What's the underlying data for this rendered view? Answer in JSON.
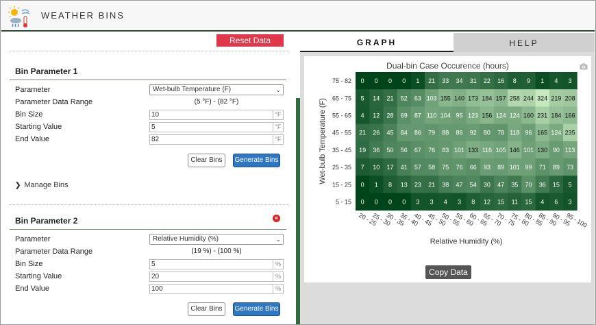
{
  "app": {
    "title": "WEATHER BINS",
    "logo_icon": "weather-logo-icon"
  },
  "left": {
    "reset_label": "Reset Data",
    "bin1": {
      "title": "Bin Parameter 1",
      "parameter_label": "Parameter",
      "parameter_value": "Wet-bulb Temperature (F)",
      "range_label": "Parameter Data Range",
      "range_value": "(5 °F) - (82 °F)",
      "size_label": "Bin Size",
      "size_value": "10",
      "start_label": "Starting Value",
      "start_value": "5",
      "end_label": "End Value",
      "end_value": "82",
      "unit": "°F",
      "clear_label": "Clear Bins",
      "generate_label": "Generate Bins"
    },
    "manage_label": "Manage Bins",
    "bin2": {
      "title": "Bin Parameter 2",
      "parameter_label": "Parameter",
      "parameter_value": "Relative Humidity (%)",
      "range_label": "Parameter Data Range",
      "range_value": "(19 %) - (100 %)",
      "size_label": "Bin Size",
      "size_value": "5",
      "start_label": "Starting Value",
      "start_value": "20",
      "end_label": "End Value",
      "end_value": "100",
      "unit": "%",
      "clear_label": "Clear Bins",
      "generate_label": "Generate Bins"
    }
  },
  "right": {
    "tab_graph": "GRAPH",
    "tab_help": "HELP",
    "copy_label": "Copy Data"
  },
  "chart_data": {
    "type": "heatmap",
    "title": "Dual-bin Case Occurence (hours)",
    "xlabel": "Relative Humidity (%)",
    "ylabel": "Wet-bulb Temperature (F)",
    "x": [
      "20 - 25",
      "25 - 30",
      "30 - 35",
      "35 - 40",
      "40 - 45",
      "45 - 50",
      "50 - 55",
      "55 - 60",
      "60 - 65",
      "65 - 70",
      "70 - 75",
      "75 - 80",
      "80 - 85",
      "85 - 90",
      "90 - 95",
      "95 - 100"
    ],
    "y": [
      "75 - 82",
      "65 - 75",
      "55 - 65",
      "45 - 55",
      "35 - 45",
      "25 - 35",
      "15 - 25",
      "5 - 15"
    ],
    "values": [
      [
        0,
        0,
        0,
        0,
        1,
        21,
        33,
        34,
        31,
        22,
        16,
        8,
        9,
        1,
        4,
        3
      ],
      [
        5,
        14,
        21,
        52,
        63,
        103,
        155,
        140,
        173,
        184,
        157,
        258,
        244,
        324,
        219,
        208
      ],
      [
        4,
        12,
        28,
        69,
        87,
        110,
        104,
        95,
        123,
        156,
        124,
        124,
        160,
        231,
        184,
        166
      ],
      [
        21,
        26,
        45,
        84,
        86,
        79,
        88,
        86,
        92,
        80,
        78,
        118,
        96,
        165,
        124,
        235
      ],
      [
        19,
        36,
        50,
        56,
        67,
        76,
        83,
        101,
        133,
        116,
        105,
        146,
        101,
        130,
        90,
        113
      ],
      [
        7,
        10,
        17,
        41,
        57,
        58,
        75,
        76,
        66,
        93,
        89,
        101,
        99,
        71,
        89,
        73
      ],
      [
        0,
        1,
        8,
        13,
        23,
        21,
        38,
        47,
        54,
        30,
        47,
        35,
        70,
        36,
        15,
        5
      ],
      [
        0,
        0,
        0,
        0,
        3,
        3,
        4,
        3,
        8,
        12,
        15,
        11,
        15,
        4,
        6,
        3
      ]
    ],
    "colorscale": [
      "#00441b",
      "#c7e9c0"
    ]
  }
}
